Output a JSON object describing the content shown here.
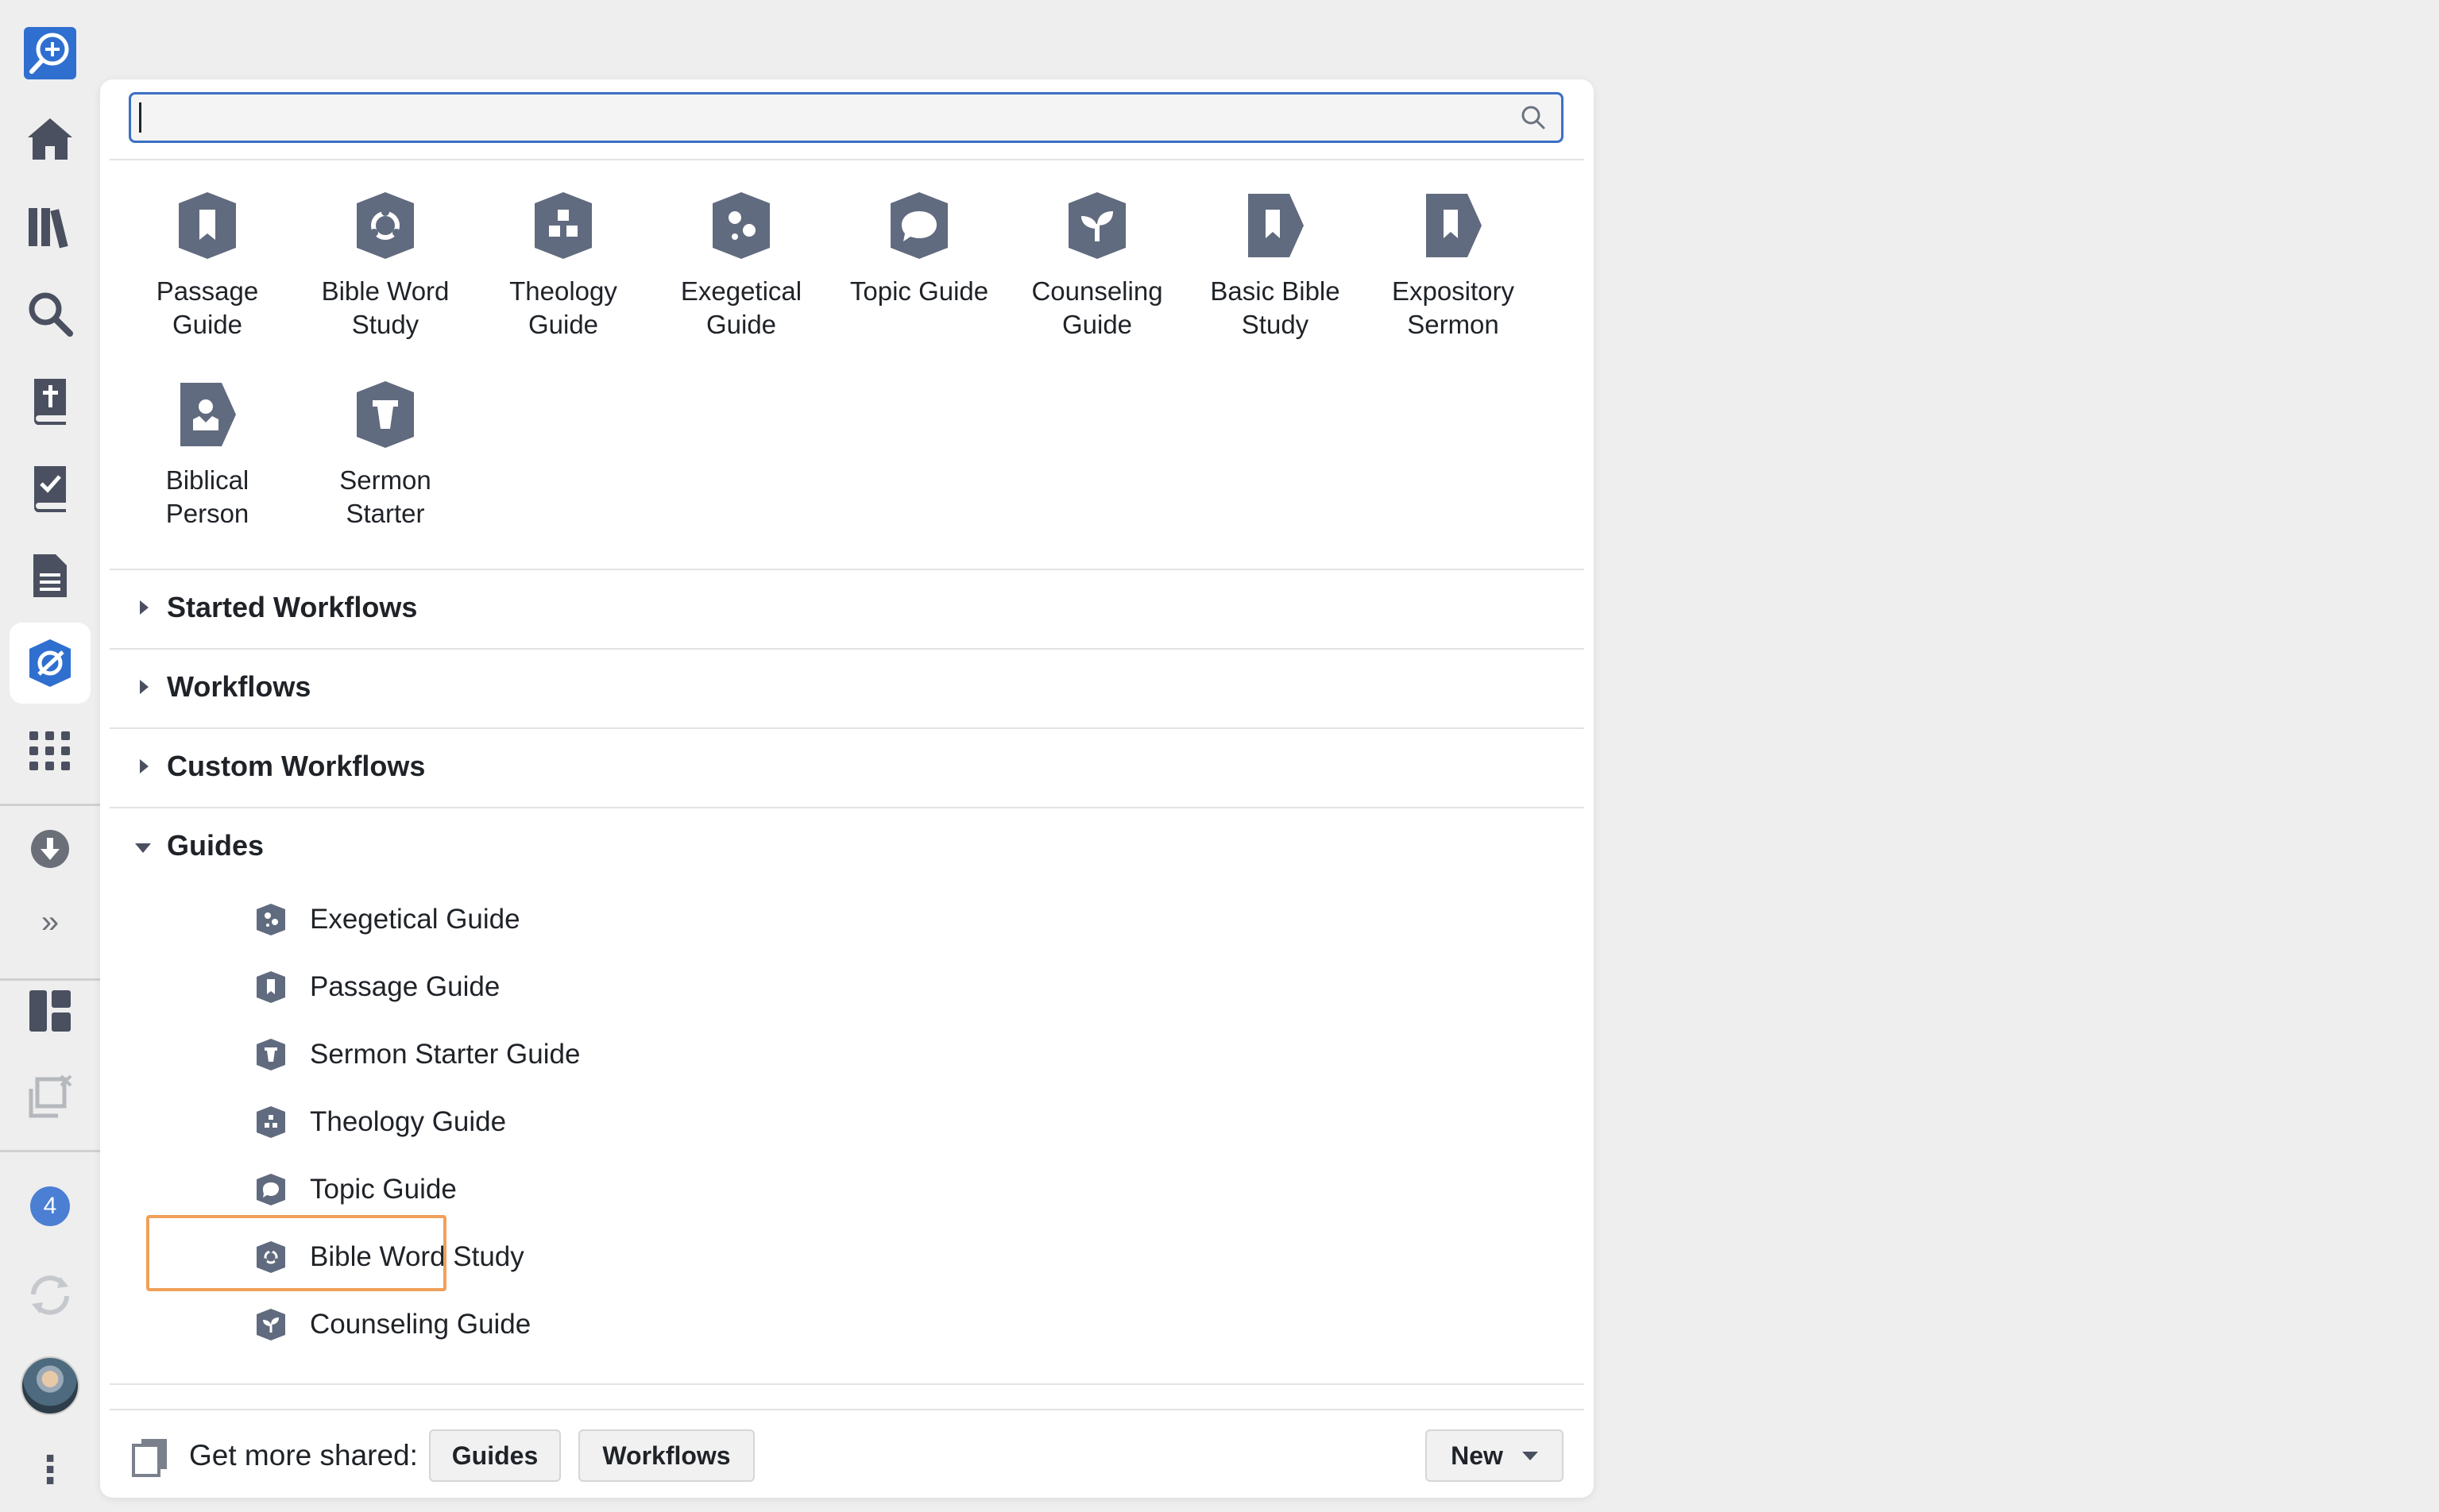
{
  "rail": {
    "badge_count": "4",
    "expand_glyph": "»",
    "more_glyph": "⋮"
  },
  "search": {
    "value": "",
    "placeholder": ""
  },
  "tiles": [
    {
      "label": "Passage\nGuide",
      "icon": "passage-guide-icon"
    },
    {
      "label": "Bible Word\nStudy",
      "icon": "bible-word-study-icon"
    },
    {
      "label": "Theology\nGuide",
      "icon": "theology-guide-icon"
    },
    {
      "label": "Exegetical\nGuide",
      "icon": "exegetical-guide-icon"
    },
    {
      "label": "Topic Guide",
      "icon": "topic-guide-icon"
    },
    {
      "label": "Counseling\nGuide",
      "icon": "counseling-guide-icon"
    },
    {
      "label": "Basic Bible\nStudy",
      "icon": "basic-bible-study-icon"
    },
    {
      "label": "Expository\nSermon",
      "icon": "expository-sermon-icon"
    },
    {
      "label": "Biblical\nPerson",
      "icon": "biblical-person-icon"
    },
    {
      "label": "Sermon\nStarter",
      "icon": "sermon-starter-icon"
    }
  ],
  "sections": {
    "started": "Started Workflows",
    "workflows": "Workflows",
    "custom": "Custom Workflows",
    "guides": "Guides"
  },
  "guides": [
    {
      "label": "Exegetical Guide"
    },
    {
      "label": "Passage Guide"
    },
    {
      "label": "Sermon Starter Guide"
    },
    {
      "label": "Theology Guide"
    },
    {
      "label": "Topic Guide"
    },
    {
      "label": "Bible Word Study"
    },
    {
      "label": "Counseling Guide"
    }
  ],
  "footer": {
    "get_more": "Get more shared:",
    "guides_button": "Guides",
    "workflows_button": "Workflows",
    "new_button": "New"
  },
  "colors": {
    "icon": "#616b7f",
    "accent": "#3b6fc4",
    "highlight": "#f0a05a"
  }
}
